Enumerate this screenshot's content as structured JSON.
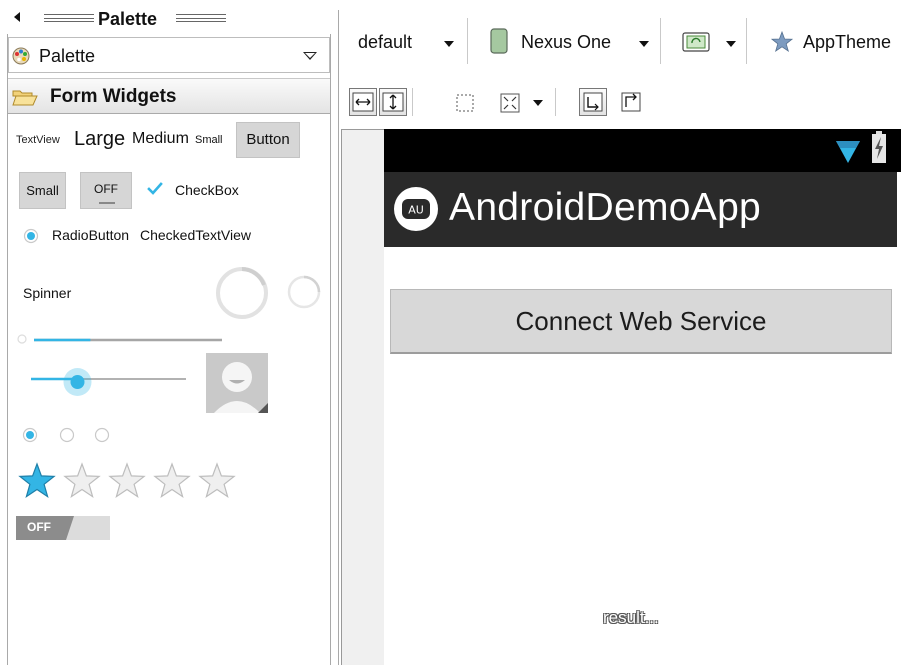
{
  "palette": {
    "title": "Palette",
    "selector_label": "Palette",
    "category": "Form Widgets",
    "widgets": {
      "textview": "TextView",
      "large": "Large",
      "medium": "Medium",
      "small": "Small",
      "button": "Button",
      "small_button": "Small",
      "toggle_button": "OFF",
      "checkbox": "CheckBox",
      "radio_button": "RadioButton",
      "checked_textview": "CheckedTextView",
      "spinner": "Spinner",
      "switch": "OFF"
    },
    "progress_bar_value": 0.3,
    "seekbar_value": 0.3,
    "rating_value": 1,
    "rating_max": 5
  },
  "toolbar": {
    "theme_variant": "default",
    "device": "Nexus One",
    "app_theme": "AppTheme"
  },
  "device_screen": {
    "app_title": "AndroidDemoApp",
    "app_icon_text": "AU",
    "connect_button_label": "Connect Web Service",
    "result_text": "result..."
  },
  "colors": {
    "accent": "#33b5e5",
    "action_bar": "#2a2a2a",
    "status_bar": "#000000",
    "button_bg": "#d8d8d8"
  }
}
